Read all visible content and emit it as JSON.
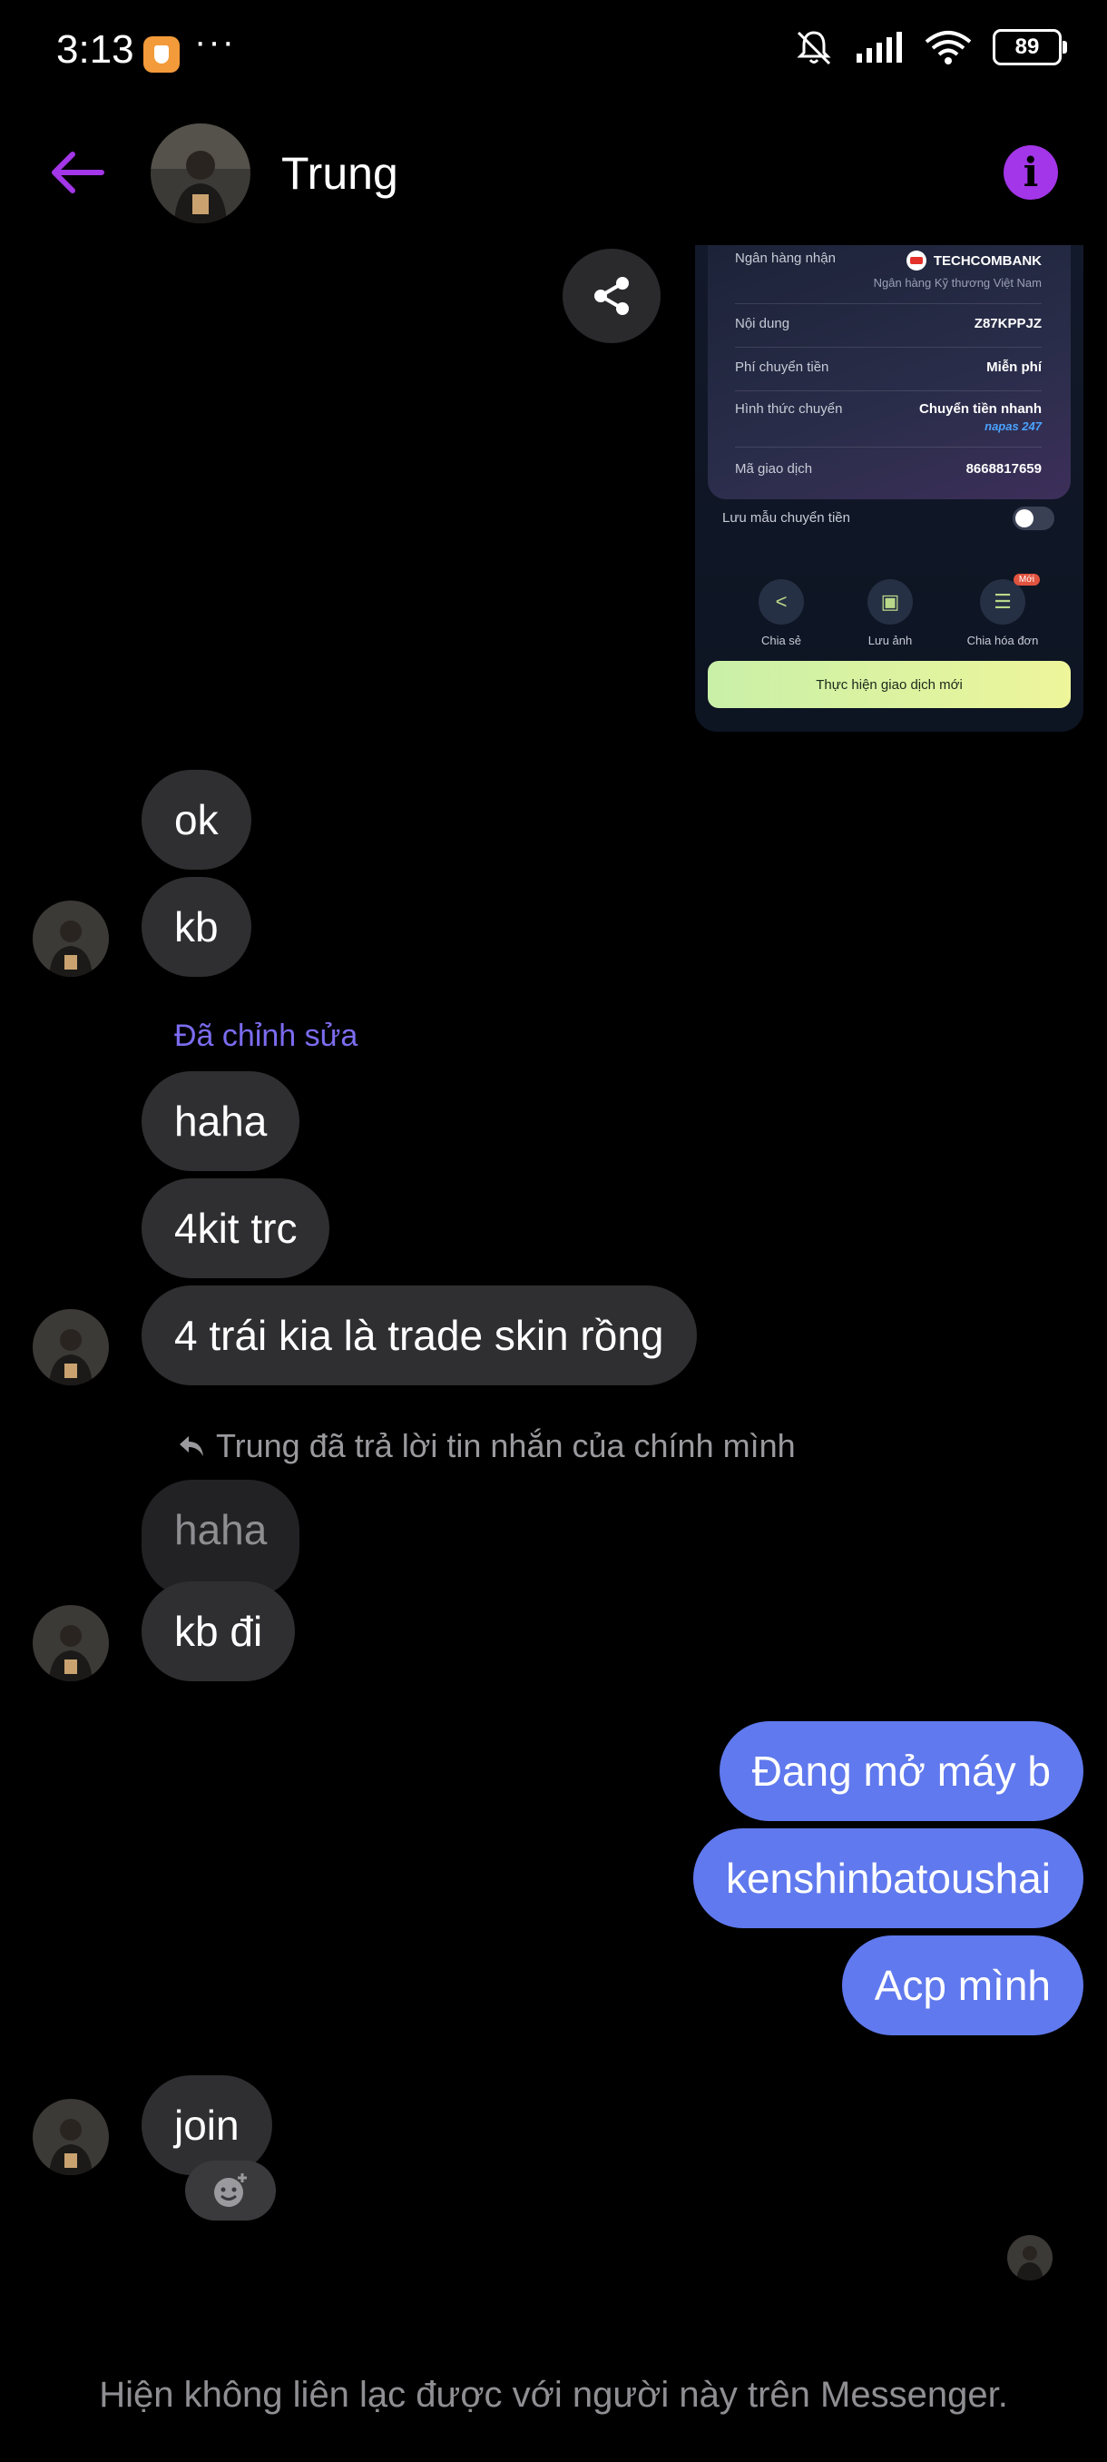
{
  "status_bar": {
    "time": "3:13",
    "more": "···",
    "battery": "89"
  },
  "header": {
    "contact_name": "Trung"
  },
  "receipt": {
    "rows": [
      {
        "label": "Ngân hàng nhận",
        "value": "TECHCOMBANK",
        "sub": "Ngân hàng Kỹ thương Việt Nam"
      },
      {
        "label": "Nội dung",
        "value": "Z87KPPJZ"
      },
      {
        "label": "Phí chuyển tiền",
        "value": "Miễn phí"
      },
      {
        "label": "Hình thức chuyển",
        "value": "Chuyển tiền nhanh",
        "sub": "napas 247"
      },
      {
        "label": "Mã giao dịch",
        "value": "8668817659"
      }
    ],
    "save_template_label": "Lưu mẫu chuyển tiền",
    "actions": [
      {
        "label": "Chia sẻ"
      },
      {
        "label": "Lưu ảnh"
      },
      {
        "label": "Chia hóa đơn",
        "badge": "Mới"
      }
    ],
    "cta": "Thực hiện giao dịch mới"
  },
  "messages": {
    "ok": "ok",
    "kb": "kb",
    "edited_label": "Đã chỉnh sửa",
    "haha": "haha",
    "fourkit": "4kit trc",
    "trade": "4 trái kia là trade skin rồng",
    "reply_note": "Trung đã trả lời tin nhắn của chính mình",
    "quoted": "haha",
    "kbdi": "kb đi",
    "out1": "Đang mở máy b",
    "out2": "kenshinbatoushai",
    "out3": "Acp mình",
    "join": "join"
  },
  "footer": {
    "notice": "Hiện không liên lạc được với người này trên Messenger."
  },
  "colors": {
    "accent": "#a336e8",
    "outgoing_bubble": "#6079ee",
    "incoming_bubble": "#2f2f31",
    "edited_label": "#7b6cf0"
  }
}
